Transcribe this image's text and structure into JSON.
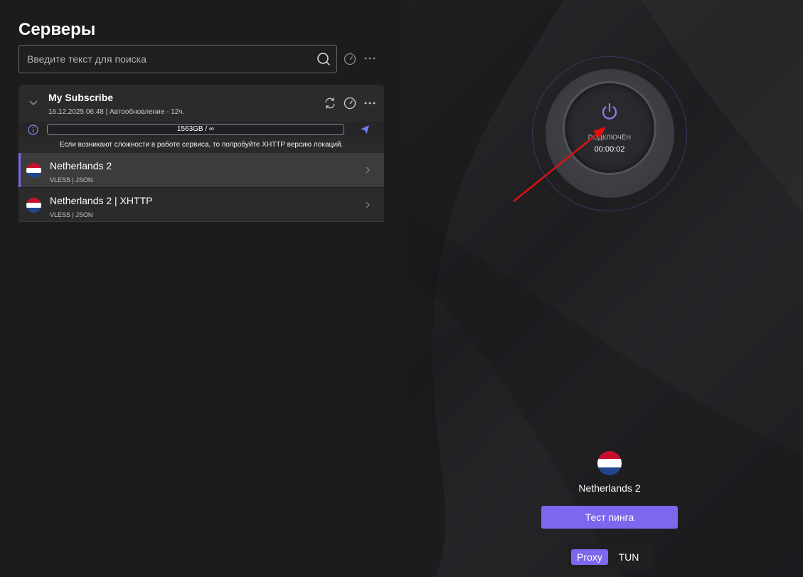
{
  "left": {
    "title": "Серверы",
    "search": {
      "placeholder": "Введите текст для поиска"
    },
    "group": {
      "name": "My Subscribe",
      "meta": "16.12.2025 06:48 | Автообновление - 12ч.",
      "traffic": "1563GB / ∞",
      "notice": "Если возникают сложности в работе сервиса, то попробуйте XHTTP версию локаций.",
      "servers": [
        {
          "name": "Netherlands 2",
          "proto": "VLESS | JSON"
        },
        {
          "name": "Netherlands 2 | XHTTP",
          "proto": "VLESS | JSON"
        }
      ]
    }
  },
  "right": {
    "status": "ПОДКЛЮЧЁН",
    "timer": "00:00:02",
    "current_server": "Netherlands 2",
    "ping_button": "Тест пинга",
    "modes": {
      "proxy": "Proxy",
      "tun": "TUN"
    }
  },
  "colors": {
    "accent": "#7b68ee",
    "arrow": "#e01010"
  }
}
